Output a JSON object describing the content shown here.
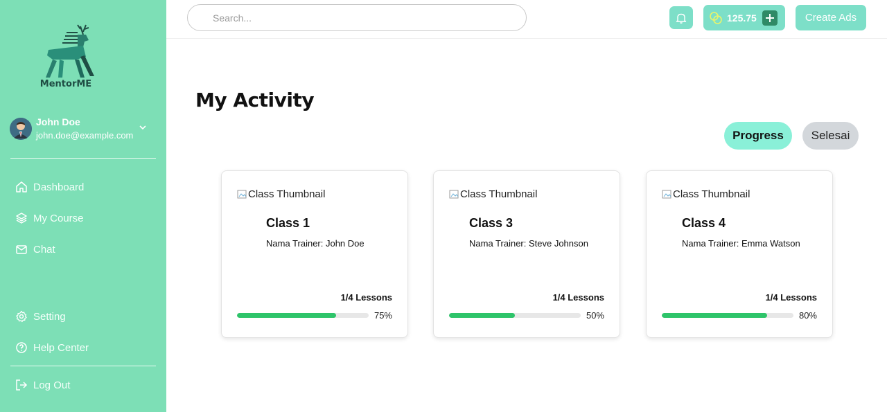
{
  "brand": {
    "name": "MentorME"
  },
  "user": {
    "name": "John Doe",
    "email": "john.doe@example.com"
  },
  "sidebar": {
    "items": [
      {
        "label": "Dashboard",
        "icon": "home-icon"
      },
      {
        "label": "My Course",
        "icon": "layers-icon"
      },
      {
        "label": "Chat",
        "icon": "mail-icon"
      }
    ],
    "bottom_items": [
      {
        "label": "Setting",
        "icon": "gear-icon"
      },
      {
        "label": "Help Center",
        "icon": "help-circle-icon"
      }
    ],
    "logout_label": "Log Out"
  },
  "header": {
    "search_placeholder": "Search...",
    "coin_balance": "125.75",
    "create_ads_label": "Create Ads"
  },
  "main": {
    "title": "My Activity",
    "tabs": [
      {
        "label": "Progress",
        "active": true
      },
      {
        "label": "Selesai",
        "active": false
      }
    ],
    "cards": [
      {
        "thumbnail_alt": "Class Thumbnail",
        "title": "Class 1",
        "trainer": "Nama Trainer: John Doe",
        "lessons": "1/4 Lessons",
        "progress": 75,
        "progress_label": "75%"
      },
      {
        "thumbnail_alt": "Class Thumbnail",
        "title": "Class 3",
        "trainer": "Nama Trainer: Steve Johnson",
        "lessons": "1/4 Lessons",
        "progress": 50,
        "progress_label": "50%"
      },
      {
        "thumbnail_alt": "Class Thumbnail",
        "title": "Class 4",
        "trainer": "Nama Trainer: Emma Watson",
        "lessons": "1/4 Lessons",
        "progress": 80,
        "progress_label": "80%"
      }
    ]
  },
  "colors": {
    "sidebar_bg": "#7ddfb6",
    "accent": "#7ddfc8",
    "progress_fill": "#2ec46a",
    "tab_active": "#8af0d8",
    "tab_inactive": "#d3d7db"
  }
}
